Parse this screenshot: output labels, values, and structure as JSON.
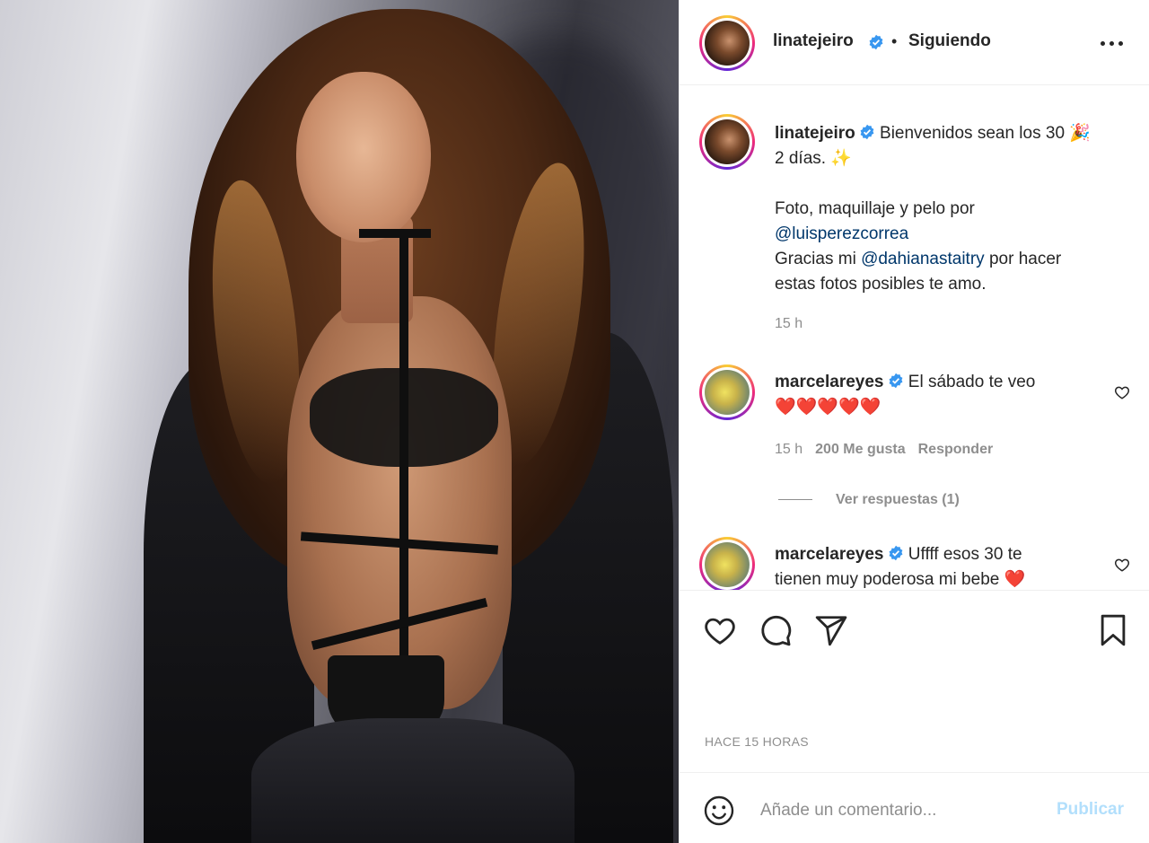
{
  "post": {
    "image_alt": "",
    "author": "linatejeiro",
    "follow_status": "Siguiendo",
    "separator": "•"
  },
  "caption": {
    "username": "linatejeiro",
    "line1": "Bienvenidos sean los 30 🎉",
    "line2": "2 días. ✨",
    "line3": "Foto, maquillaje y pelo por",
    "mention1": "@luisperezcorrea",
    "line4_pre": "Gracias mi ",
    "mention2": "@dahianastaitry",
    "line4_post": " por hacer",
    "line5": "estas fotos posibles te amo.",
    "time": "15 h"
  },
  "comments": [
    {
      "username": "marcelareyes",
      "text": "El sábado te veo",
      "emojis": "❤️❤️❤️❤️❤️",
      "time": "15 h",
      "likes": "200 Me gusta",
      "reply": "Responder",
      "view_replies": "Ver respuestas (1)"
    },
    {
      "username": "marcelareyes",
      "text": "Uffff esos 30 te",
      "text2": "tienen muy poderosa mi bebe ❤️"
    }
  ],
  "timestamp": "HACE 15 HORAS",
  "add_comment": {
    "placeholder": "Añade un comentario...",
    "publish_label": "Publicar"
  },
  "icons": {
    "like": "heart-icon",
    "comment": "comment-icon",
    "share": "share-icon",
    "save": "bookmark-icon",
    "emoji": "emoji-icon",
    "more": "more-options-icon",
    "verified": "verified-badge-icon"
  },
  "colors": {
    "text": "#262626",
    "secondary": "#8e8e8e",
    "mention": "#00376b",
    "verified": "#3897f0",
    "like_red": "#ed4956",
    "publish_disabled": "#b2dffc"
  }
}
